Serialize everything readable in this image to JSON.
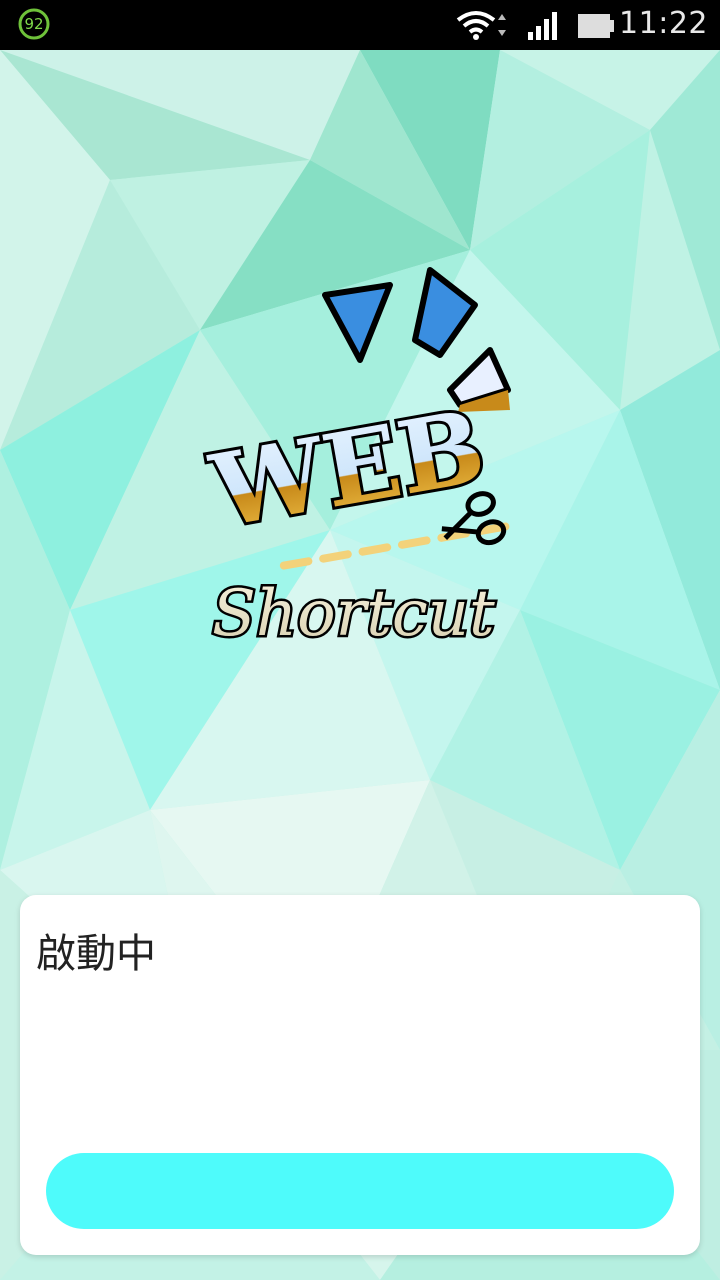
{
  "status_bar": {
    "notification_badge": "92",
    "time": "11:22",
    "icons": [
      "wifi-icon",
      "signal-icon",
      "battery-icon"
    ]
  },
  "logo": {
    "line1": "WEB",
    "line2": "Shortcut",
    "icon": "scissors-icon"
  },
  "dialog": {
    "message": "啟動中",
    "progress_color": "#4efbfb"
  },
  "colors": {
    "background": "#bff2e4",
    "accent": "#4efbfb"
  }
}
